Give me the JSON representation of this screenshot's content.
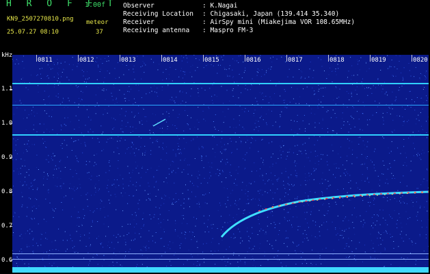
{
  "header": {
    "app_name": "H R O F F T",
    "version": "1.00f",
    "filename": "KN9_2507270810.png",
    "mode": "meteor",
    "datetime": "25.07.27 08:10",
    "count": "37",
    "info_rows": [
      {
        "label": "Observer",
        "value": ": K.Nagai"
      },
      {
        "label": "Receiving Location",
        "value": ": Chigasaki, Japan (139.414 35.340)"
      },
      {
        "label": "Receiver",
        "value": ": AirSpy mini (Miakejima VOR 108.65MHz)"
      },
      {
        "label": "Receiving antenna",
        "value": ": Maspro FM-3"
      }
    ]
  },
  "spectrogram": {
    "y_unit": "kHz",
    "y_ticks": [
      "1.1",
      "1.0",
      "0.9",
      "0.8",
      "0.7",
      "0.6"
    ],
    "x_ticks": [
      "0811",
      "0812",
      "0813",
      "0814",
      "0815",
      "0816",
      "0817",
      "0818",
      "0819",
      "0820"
    ],
    "colors": {
      "background": "#0b1a8a",
      "trace": "#40e0ff",
      "hot": "#ff3040"
    }
  }
}
